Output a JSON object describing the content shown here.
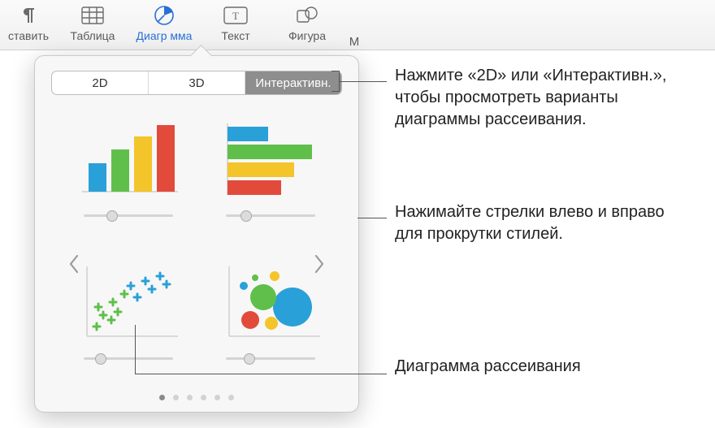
{
  "toolbar": {
    "insert": "ставить",
    "table": "Таблица",
    "chart": "Диагр мма",
    "text": "Текст",
    "shape": "Фигура",
    "more": "М"
  },
  "segmented": {
    "two_d": "2D",
    "three_d": "3D",
    "interactive": "Интерактивн."
  },
  "callouts": {
    "top": "Нажмите «2D» или «Интерактивн.», чтобы просмотреть варианты диаграммы рассеивания.",
    "mid": "Нажимайте стрелки влево и вправо для прокрутки стилей.",
    "bottom": "Диаграмма рассеивания"
  }
}
